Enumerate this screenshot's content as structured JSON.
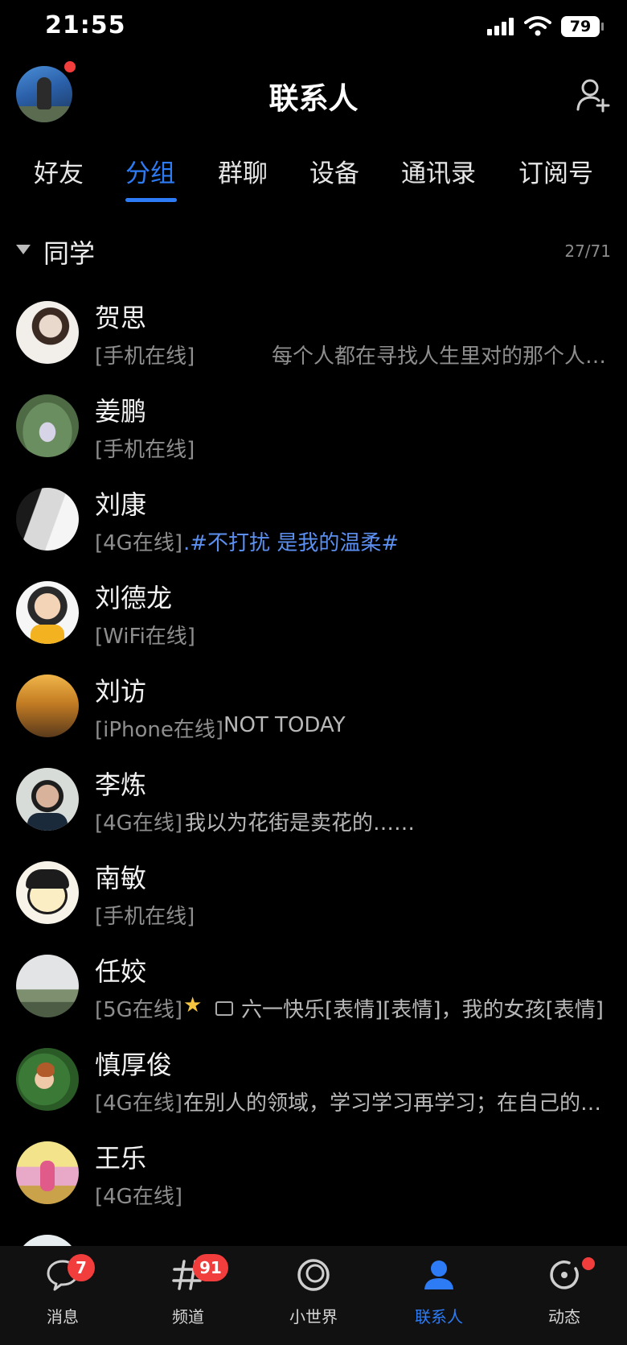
{
  "status_bar": {
    "time": "21:55",
    "battery": "79"
  },
  "header": {
    "title": "联系人"
  },
  "tabs": [
    {
      "label": "好友"
    },
    {
      "label": "分组"
    },
    {
      "label": "群聊"
    },
    {
      "label": "设备"
    },
    {
      "label": "通讯录"
    },
    {
      "label": "订阅号"
    }
  ],
  "group": {
    "name": "同学",
    "count": "27/71"
  },
  "contacts": [
    {
      "name": "贺思",
      "status": "[手机在线]",
      "signature": "每个人都在寻找人生里对的那个人…"
    },
    {
      "name": "姜鹏",
      "status": "[手机在线]",
      "signature": ""
    },
    {
      "name": "刘康",
      "status": "[4G在线]",
      "signature": ".#不打扰 是我的温柔#"
    },
    {
      "name": "刘德龙",
      "status": "[WiFi在线]",
      "signature": ""
    },
    {
      "name": "刘访",
      "status": "[iPhone在线]",
      "signature": "NOT TODAY"
    },
    {
      "name": "李炼",
      "status": "[4G在线]",
      "signature": "我以为花街是卖花的……"
    },
    {
      "name": "南敏",
      "status": "[手机在线]",
      "signature": ""
    },
    {
      "name": "任姣",
      "status": "[5G在线]",
      "signature": "六一快乐[表情][表情]，我的女孩[表情]"
    },
    {
      "name": "慎厚俊",
      "status": "[4G在线]",
      "signature": "在别人的领域，学习学习再学习；在自己的…"
    },
    {
      "name": "王乐",
      "status": "[4G在线]",
      "signature": ""
    }
  ],
  "bottom_nav": [
    {
      "label": "消息",
      "badge": "7",
      "icon": "message-icon"
    },
    {
      "label": "频道",
      "badge": "91",
      "icon": "channel-icon"
    },
    {
      "label": "小世界",
      "badge": "",
      "icon": "small-world-icon"
    },
    {
      "label": "联系人",
      "badge": "",
      "icon": "contacts-icon"
    },
    {
      "label": "动态",
      "badge": "",
      "icon": "feed-icon"
    }
  ],
  "colors": {
    "accent": "#2d7cf6",
    "badge": "#f23d3d",
    "background": "#000000"
  }
}
